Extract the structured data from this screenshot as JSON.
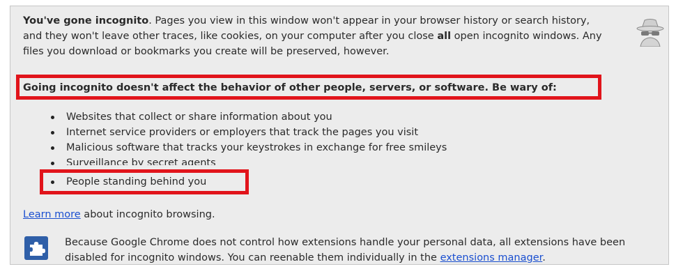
{
  "intro": {
    "lead": "You've gone incognito",
    "text_before_all": ". Pages you view in this window won't appear in your browser history or search history, and they won't leave other traces, like cookies, on your computer after you close ",
    "all_word": "all",
    "text_after_all": " open incognito windows. Any files you download or bookmarks you create will be preserved, however."
  },
  "icons": {
    "incognito": "incognito-spy-icon",
    "extensions": "puzzle-piece-icon"
  },
  "warning": "Going incognito doesn't affect the behavior of other people, servers, or software. Be wary of:",
  "wary_items": [
    "Websites that collect or share information about you",
    "Internet service providers or employers that track the pages you visit",
    "Malicious software that tracks your keystrokes in exchange for free smileys",
    "Surveillance by secret agents",
    "People standing behind you"
  ],
  "learn_more": {
    "link": "Learn more",
    "rest": " about incognito browsing."
  },
  "extensions": {
    "text": "Because Google Chrome does not control how extensions handle your personal data, all extensions have been disabled for incognito windows. You can reenable them individually in the ",
    "link": "extensions manager",
    "end": "."
  },
  "colors": {
    "highlight": "#e1141b",
    "link": "#1a4fd0",
    "background": "#ececec"
  }
}
